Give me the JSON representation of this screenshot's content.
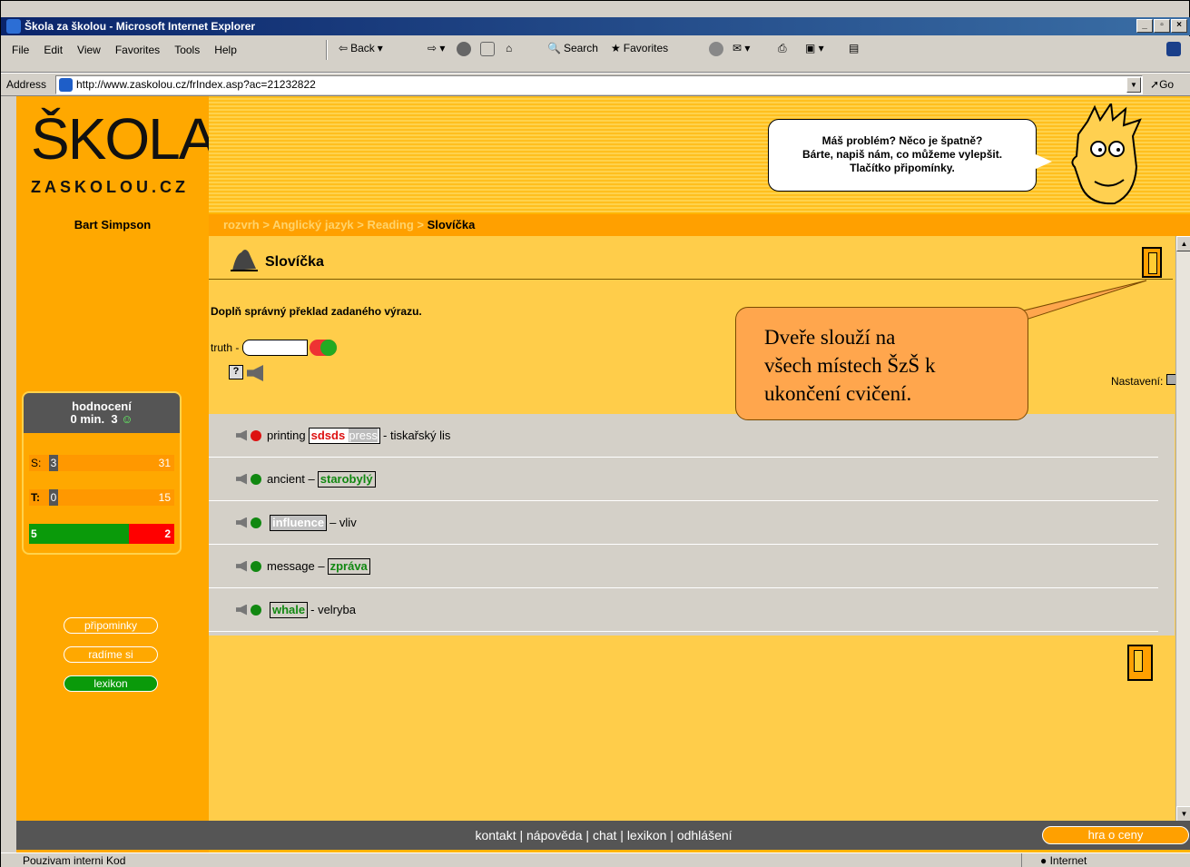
{
  "window": {
    "title": "Škola za školou - Microsoft Internet Explorer"
  },
  "menubar": {
    "items": [
      "File",
      "Edit",
      "View",
      "Favorites",
      "Tools",
      "Help"
    ]
  },
  "toolbar": {
    "back": "Back",
    "search": "Search",
    "favorites": "Favorites"
  },
  "address": {
    "label": "Address",
    "url": "http://www.zaskolou.cz/frIndex.asp?ac=21232822",
    "go": "Go"
  },
  "logo": {
    "big": "ŠKOLA",
    "small": "ZASKOLOU.CZ"
  },
  "bubble": {
    "line1": "Máš problém? Něco je špatně?",
    "line2": "Bárte, napiš nám, co můžeme vylepšit.",
    "line3": "Tlačítko připomínky."
  },
  "sidebar": {
    "user": "Bart Simpson",
    "hodnoceni": {
      "title": "hodnocení",
      "time": "0 min.",
      "score": "3"
    },
    "s": {
      "label": "S:",
      "value": "3",
      "max": "31"
    },
    "t": {
      "label": "T:",
      "value": "0",
      "max": "15"
    },
    "correct": "5",
    "wrong": "2",
    "buttons": {
      "pripominky": "připominky",
      "radime": "radíme si",
      "lexikon": "lexikon"
    }
  },
  "breadcrumb": {
    "path": "rozvrh > Anglický jazyk > Reading > ",
    "current": "Slovíčka"
  },
  "content": {
    "title": "Slovíčka",
    "instruction": "Doplň správný překlad zadaného výrazu.",
    "truth_label": "truth -",
    "settings_label": "Nastavení:"
  },
  "words": [
    {
      "pre": "printing",
      "tag": "sdsds",
      "tag2": "press",
      "post": "- tiskařský lis"
    },
    {
      "pre": "ancient –",
      "tag": "starobylý",
      "post": ""
    },
    {
      "pre": "",
      "tag": "influence",
      "post": "– vliv"
    },
    {
      "pre": "message –",
      "tag": "zpráva",
      "post": ""
    },
    {
      "pre": "",
      "tag": "whale",
      "post": "- velryba"
    }
  ],
  "callout": {
    "line1": "Dveře slouží na",
    "line2": "všech místech ŠzŠ k",
    "line3": "ukončení cvičení."
  },
  "footer": {
    "links": "kontakt |  nápověda |  chat |  lexikon |  odhlášení",
    "hra": "hra o ceny"
  },
  "status": {
    "text": "Pouzivam interni Kod",
    "zone": "Internet"
  }
}
